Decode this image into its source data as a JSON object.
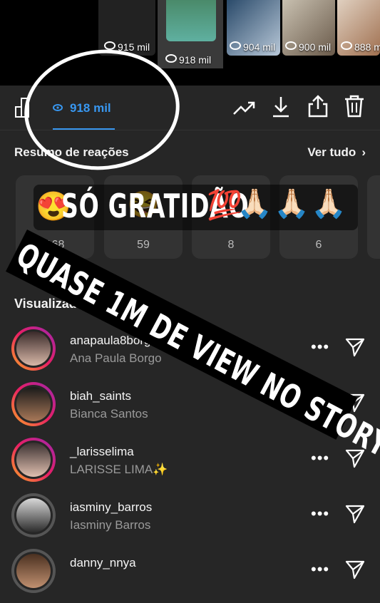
{
  "story_thumbnails": [
    {
      "views": "915 mil"
    },
    {
      "views": "918 mil",
      "selected": true
    },
    {
      "views": "904 mil"
    },
    {
      "views": "900 mil"
    },
    {
      "views": "888 m"
    }
  ],
  "toolbar": {
    "views_tab": "918 mil",
    "icons": [
      "bar-chart-icon",
      "eye-icon",
      "trending-icon",
      "download-icon",
      "share-icon",
      "trash-icon"
    ]
  },
  "reactions": {
    "title": "Resumo de reações",
    "see_all": "Ver tudo",
    "counts": [
      "168",
      "59",
      "8",
      "6"
    ]
  },
  "sticker": {
    "text": "SÓ GRATIDÃO",
    "emojis": [
      "😍",
      "💯",
      "🙏🏻",
      "🙏🏻",
      "🙏🏻"
    ]
  },
  "banner": {
    "text": "QUASE 1M DE VIEW NO STORY"
  },
  "viewers": {
    "title": "Visualizadores",
    "list": [
      {
        "username": "anapaula8borgo",
        "full_name": "Ana Paula Borgo",
        "verified": true
      },
      {
        "username": "biah_saints",
        "full_name": "Bianca Santos"
      },
      {
        "username": "_larisselima",
        "full_name": "LARISSE  LIMA✨"
      },
      {
        "username": "iasminy_barros",
        "full_name": "Iasminy Barros"
      },
      {
        "username": "danny_nnya",
        "full_name": ""
      }
    ],
    "more_label": "•••"
  },
  "colors": {
    "accent": "#3897f0",
    "background": "#262626",
    "ring_gradient": [
      "#f9a825",
      "#e91e63",
      "#9c27b0"
    ]
  }
}
